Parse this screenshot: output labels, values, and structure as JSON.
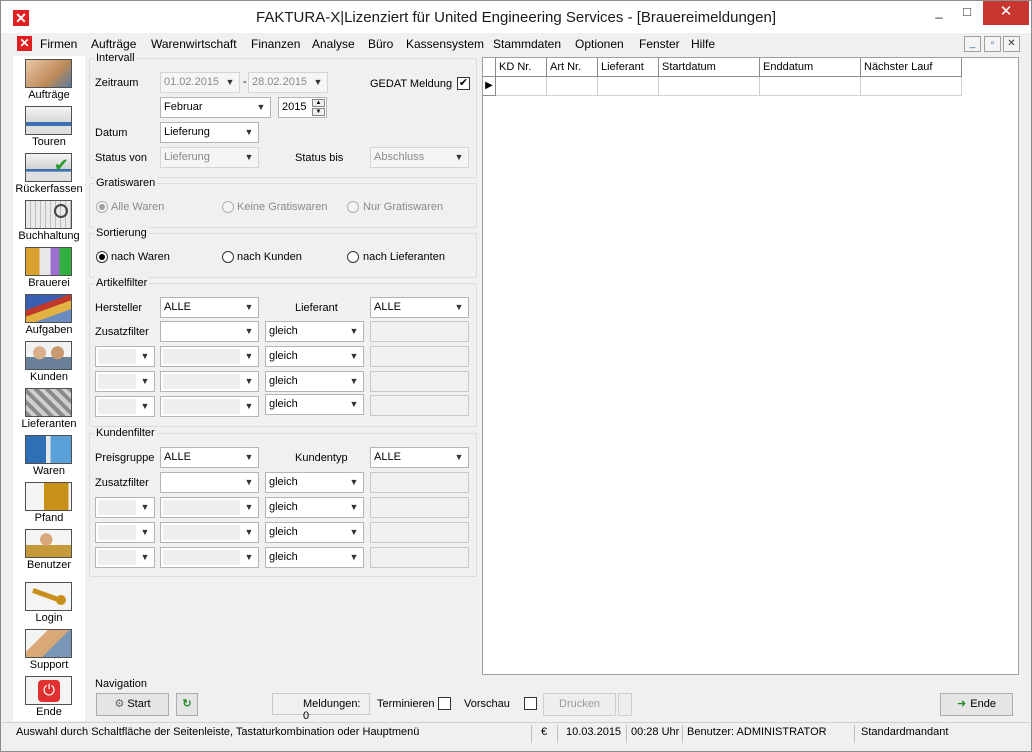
{
  "window": {
    "title": "FAKTURA-X|Lizenziert für United Engineering Services - [Brauereimeldungen]",
    "min_glyph": "_",
    "max_glyph": "□",
    "close_glyph": "✕"
  },
  "menu": {
    "items": [
      "Firmen",
      "Aufträge",
      "Warenwirtschaft",
      "Finanzen",
      "Analyse",
      "Büro",
      "Kassensystem",
      "Stammdaten",
      "Optionen",
      "Fenster",
      "Hilfe"
    ]
  },
  "sidebar": {
    "items": [
      {
        "label": "Aufträge",
        "icon": "headset-icon"
      },
      {
        "label": "Touren",
        "icon": "truck-icon"
      },
      {
        "label": "Rückerfassen",
        "icon": "truck-check-icon"
      },
      {
        "label": "Buchhaltung",
        "icon": "ledger-icon"
      },
      {
        "label": "Brauerei",
        "icon": "brewery-icon"
      },
      {
        "label": "Aufgaben",
        "icon": "tasks-icon"
      },
      {
        "label": "Kunden",
        "icon": "customers-icon"
      },
      {
        "label": "Lieferanten",
        "icon": "suppliers-icon"
      },
      {
        "label": "Waren",
        "icon": "goods-icon"
      },
      {
        "label": "Pfand",
        "icon": "deposit-icon"
      },
      {
        "label": "Benutzer",
        "icon": "user-icon"
      },
      {
        "label": "Login",
        "icon": "key-icon"
      },
      {
        "label": "Support",
        "icon": "handshake-icon"
      },
      {
        "label": "Ende",
        "icon": "power-icon"
      }
    ]
  },
  "intervall": {
    "title": "Intervall",
    "zeitraum_label": "Zeitraum",
    "from_date": "01.02.2015",
    "date_sep": "-",
    "to_date": "28.02.2015",
    "gedat_label": "GEDAT Meldung",
    "gedat_checked": "✔",
    "month": "Februar",
    "year": "2015",
    "datum_label": "Datum",
    "datum_value": "Lieferung",
    "status_von_label": "Status von",
    "status_von_value": "Lieferung",
    "status_bis_label": "Status bis",
    "status_bis_value": "Abschluss"
  },
  "gratiswaren": {
    "title": "Gratiswaren",
    "options": [
      "Alle Waren",
      "Keine Gratiswaren",
      "Nur Gratiswaren"
    ],
    "selected": 0
  },
  "sortierung": {
    "title": "Sortierung",
    "options": [
      "nach Waren",
      "nach Kunden",
      "nach Lieferanten"
    ],
    "selected": 0
  },
  "artikelfilter": {
    "title": "Artikelfilter",
    "hersteller_label": "Hersteller",
    "hersteller_value": "ALLE",
    "lieferant_label": "Lieferant",
    "lieferant_value": "ALLE",
    "zusatzfilter_label": "Zusatzfilter",
    "operators": [
      "gleich",
      "gleich",
      "gleich",
      "gleich"
    ]
  },
  "kundenfilter": {
    "title": "Kundenfilter",
    "preisgruppe_label": "Preisgruppe",
    "preisgruppe_value": "ALLE",
    "kundentyp_label": "Kundentyp",
    "kundentyp_value": "ALLE",
    "zusatzfilter_label": "Zusatzfilter",
    "operators": [
      "gleich",
      "gleich",
      "gleich",
      "gleich"
    ]
  },
  "grid": {
    "columns": [
      "KD Nr.",
      "Art Nr.",
      "Lieferant",
      "Startdatum",
      "Enddatum",
      "Nächster Lauf"
    ],
    "row_indicator": "▶"
  },
  "navigation": {
    "title": "Navigation",
    "start_label": "Start",
    "refresh_glyph": "↻",
    "meldungen_label": "Meldungen: 0",
    "terminieren_label": "Terminieren",
    "vorschau_label": "Vorschau",
    "drucken_label": "Drucken",
    "ende_label": "Ende"
  },
  "statusbar": {
    "hint": "Auswahl durch Schaltfläche der Seitenleiste, Tastaturkombination oder Hauptmenü",
    "currency": "€",
    "date": "10.03.2015",
    "time": "00:28 Uhr",
    "user": "Benutzer: ADMINISTRATOR",
    "mandant": "Standardmandant"
  },
  "colors": {
    "accent_red": "#e02020",
    "close_red": "#c7372f",
    "panel_bg": "#f0f0f0"
  }
}
